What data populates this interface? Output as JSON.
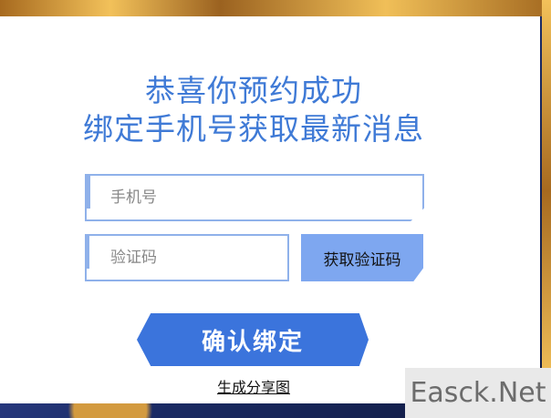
{
  "header": {
    "title_line1": "恭喜你预约成功",
    "title_line2": "绑定手机号获取最新消息"
  },
  "form": {
    "phone_placeholder": "手机号",
    "code_placeholder": "验证码",
    "get_code_label": "获取验证码",
    "confirm_label": "确认绑定"
  },
  "footer": {
    "share_link": "生成分享图"
  },
  "watermark": {
    "text": "Easck.Net"
  },
  "colors": {
    "accent": "#3f7ad6",
    "button_primary": "#3b74dc",
    "button_secondary": "#7ea7f0",
    "field_border": "#8fb1ea"
  }
}
